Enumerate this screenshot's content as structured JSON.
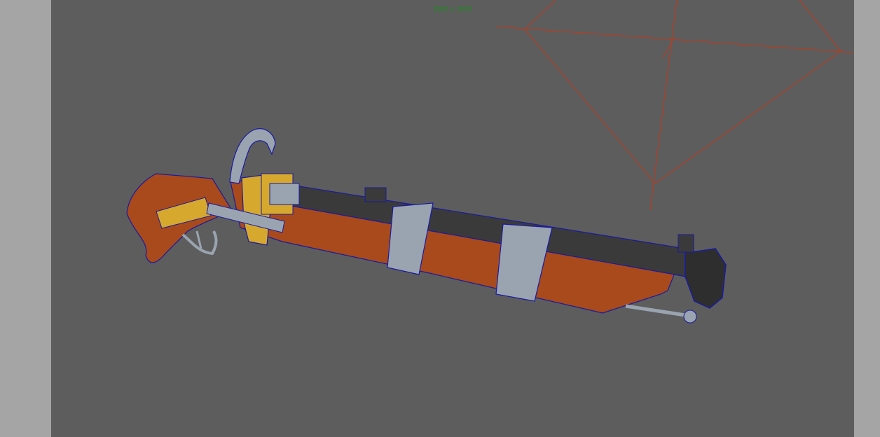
{
  "viewport": {
    "resolution_gate_label": "1500 x 1500"
  },
  "colors": {
    "viewport_background": "#5d5d5d",
    "outside_gate": "#a5a5a5",
    "resolution_label": "#2f7f2f",
    "light_gizmo": "#c23a1a",
    "wireframe": "#1a1aa0",
    "wood": "#a94a1c",
    "brass": "#d6a92e",
    "steel_band": "#9aa4b0",
    "barrel": "#3a3a3a"
  },
  "scene": {
    "object": "flintlock-pistol-model",
    "light": "spot-light-gizmo"
  }
}
